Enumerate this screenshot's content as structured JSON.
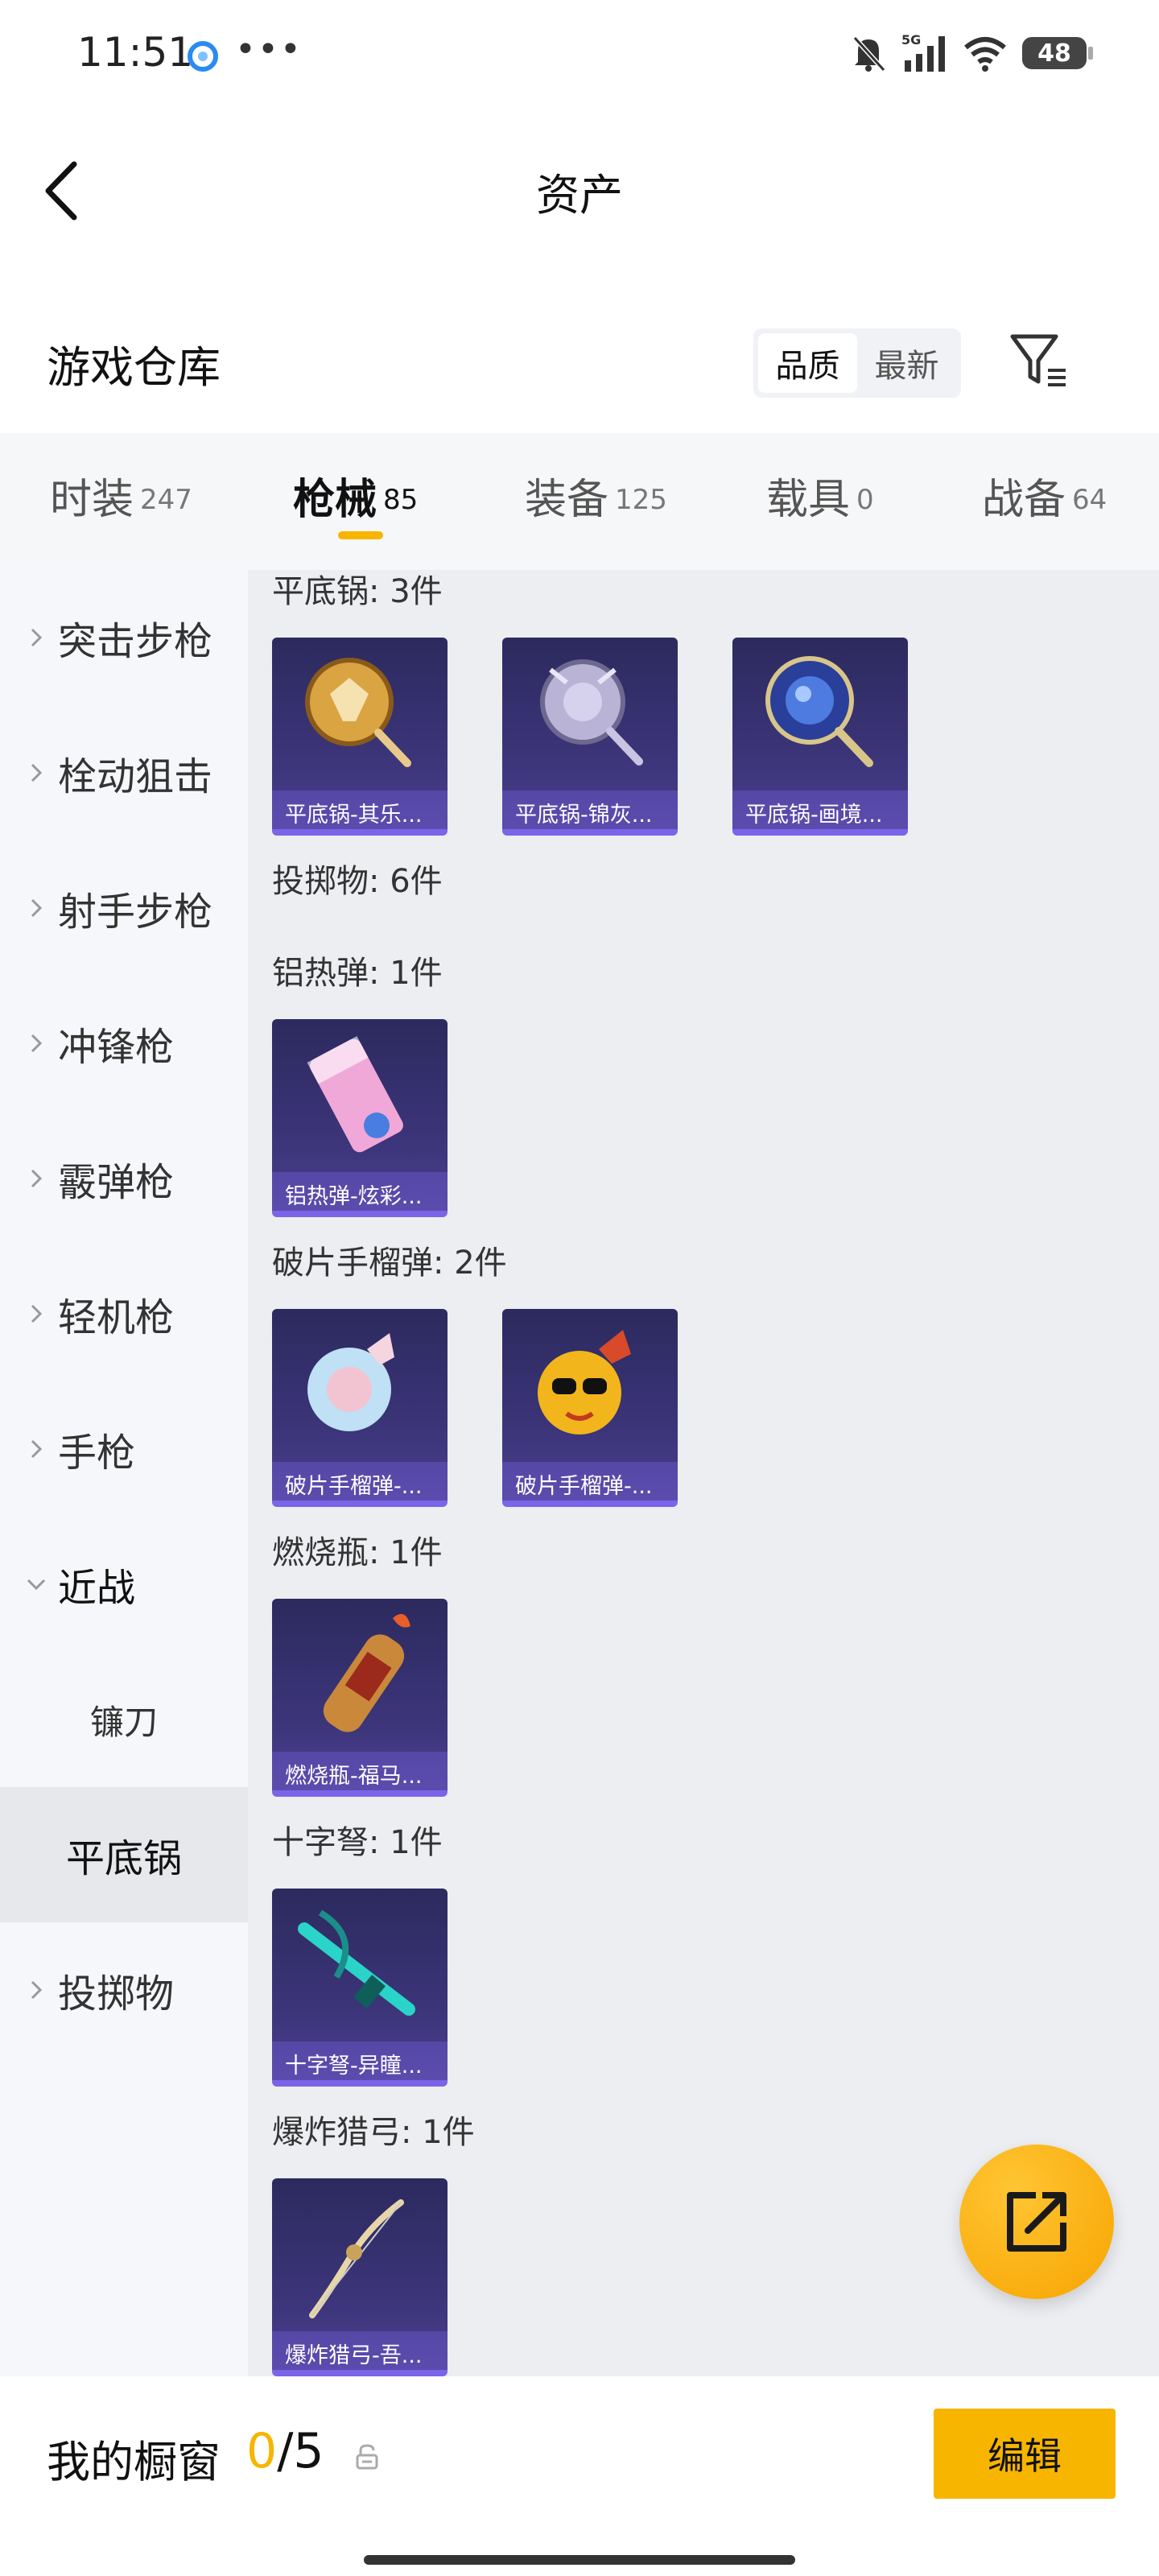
{
  "status_bar": {
    "time": "11:51",
    "network": "5G",
    "battery": "48"
  },
  "header": {
    "title": "资产"
  },
  "warehouse": {
    "title": "游戏仓库",
    "sort_options": [
      "品质",
      "最新"
    ],
    "active_sort": "品质"
  },
  "tabs": [
    {
      "label": "时装",
      "count": "247"
    },
    {
      "label": "枪械",
      "count": "85",
      "active": true
    },
    {
      "label": "装备",
      "count": "125"
    },
    {
      "label": "载具",
      "count": "0"
    },
    {
      "label": "战备",
      "count": "64"
    }
  ],
  "sidebar": {
    "items": [
      "突击步枪",
      "栓动狙击",
      "射手步枪",
      "冲锋枪",
      "霰弹枪",
      "轻机枪",
      "手枪",
      "近战",
      "投掷物"
    ],
    "sub_items": [
      "镰刀",
      "平底锅"
    ],
    "expanded": "近战",
    "selected": "平底锅"
  },
  "content": {
    "sections": [
      {
        "title": "平底锅: 3件",
        "items": [
          "平底锅-其乐...",
          "平底锅-锦灰...",
          "平底锅-画境..."
        ]
      },
      {
        "title": "投掷物: 6件",
        "items": []
      },
      {
        "title": "铝热弹: 1件",
        "items": [
          "铝热弹-炫彩..."
        ]
      },
      {
        "title": "破片手榴弹: 2件",
        "items": [
          "破片手榴弹-...",
          "破片手榴弹-..."
        ]
      },
      {
        "title": "燃烧瓶: 1件",
        "items": [
          "燃烧瓶-福马..."
        ]
      },
      {
        "title": "十字弩: 1件",
        "items": [
          "十字弩-异瞳..."
        ]
      },
      {
        "title": "爆炸猎弓: 1件",
        "items": [
          "爆炸猎弓-吾..."
        ]
      }
    ]
  },
  "showcase": {
    "label": "我的橱窗",
    "used": "0",
    "separator": "/",
    "total": "5",
    "edit_label": "编辑"
  },
  "colors": {
    "accent": "#f7b500",
    "card_bg": "#3b3478",
    "card_border": "#7c64e8"
  }
}
